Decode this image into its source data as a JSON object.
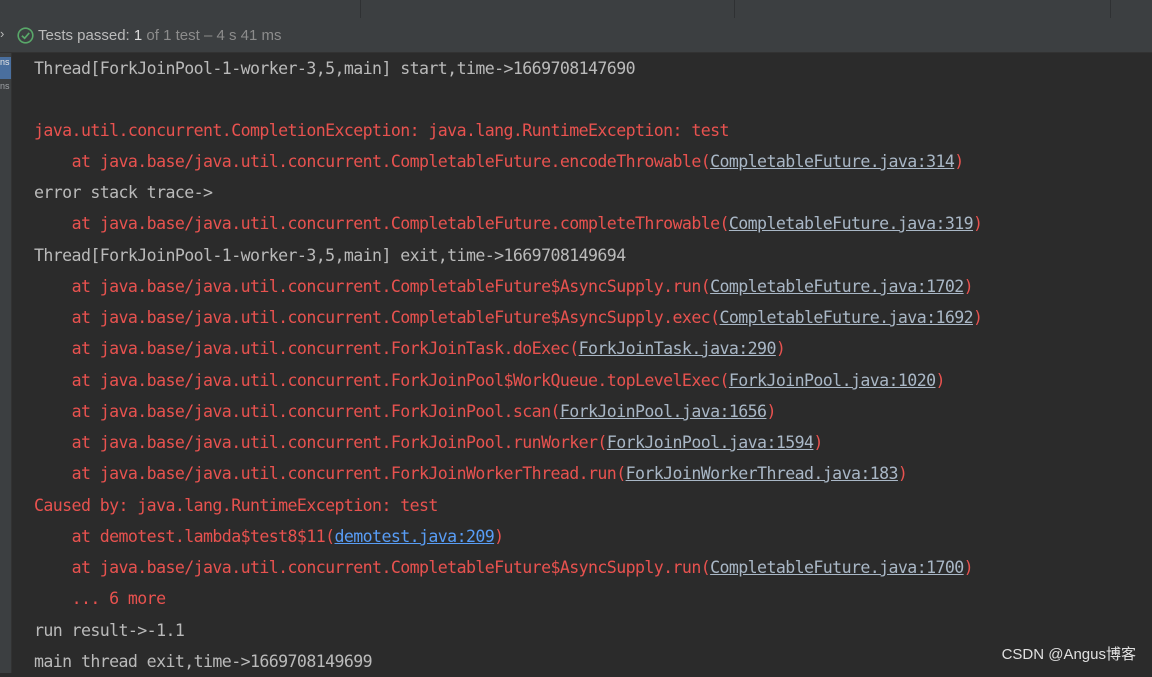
{
  "status": {
    "label": "Tests passed:",
    "count": "1",
    "of_text": "of 1 test",
    "duration": "– 4 s 41 ms"
  },
  "gutter": {
    "tab1": "ns",
    "tab2": "ns"
  },
  "console": {
    "thread_start": "Thread[ForkJoinPool-1-worker-3,5,main] start,time->1669708147690",
    "completion_exception": "java.util.concurrent.CompletionException: java.lang.RuntimeException: test",
    "frame_encode": "at java.base/java.util.concurrent.CompletableFuture.encodeThrowable",
    "link_encode": "CompletableFuture.java:314",
    "error_stack": "error stack trace->",
    "frame_complete": "at java.base/java.util.concurrent.CompletableFuture.completeThrowable",
    "link_complete": "CompletableFuture.java:319",
    "thread_exit": "Thread[ForkJoinPool-1-worker-3,5,main] exit,time->1669708149694",
    "frame_supply_run": "at java.base/java.util.concurrent.CompletableFuture$AsyncSupply.run",
    "link_supply_run": "CompletableFuture.java:1702",
    "frame_supply_exec": "at java.base/java.util.concurrent.CompletableFuture$AsyncSupply.exec",
    "link_supply_exec": "CompletableFuture.java:1692",
    "frame_doexec": "at java.base/java.util.concurrent.ForkJoinTask.doExec",
    "link_doexec": "ForkJoinTask.java:290",
    "frame_toplevel": "at java.base/java.util.concurrent.ForkJoinPool$WorkQueue.topLevelExec",
    "link_toplevel": "ForkJoinPool.java:1020",
    "frame_scan": "at java.base/java.util.concurrent.ForkJoinPool.scan",
    "link_scan": "ForkJoinPool.java:1656",
    "frame_runworker": "at java.base/java.util.concurrent.ForkJoinPool.runWorker",
    "link_runworker": "ForkJoinPool.java:1594",
    "frame_workerthread": "at java.base/java.util.concurrent.ForkJoinWorkerThread.run",
    "link_workerthread": "ForkJoinWorkerThread.java:183",
    "caused_by": "Caused by: java.lang.RuntimeException: test",
    "frame_lambda": "at demotest.lambda$test8$11",
    "link_lambda": "demotest.java:209",
    "frame_supply_run2": "at java.base/java.util.concurrent.CompletableFuture$AsyncSupply.run",
    "link_supply_run2": "CompletableFuture.java:1700",
    "more": "... 6 more",
    "run_result": "run result->-1.1",
    "main_exit": "main thread exit,time->1669708149699"
  },
  "watermark": "CSDN @Angus博客",
  "colors": {
    "background": "#2b2b2b",
    "panel": "#3c3f41",
    "stdout": "#bababa",
    "stderr": "#e8524f",
    "link": "#a9b7c6",
    "user_link": "#589df6",
    "pass_green": "#59a869"
  }
}
